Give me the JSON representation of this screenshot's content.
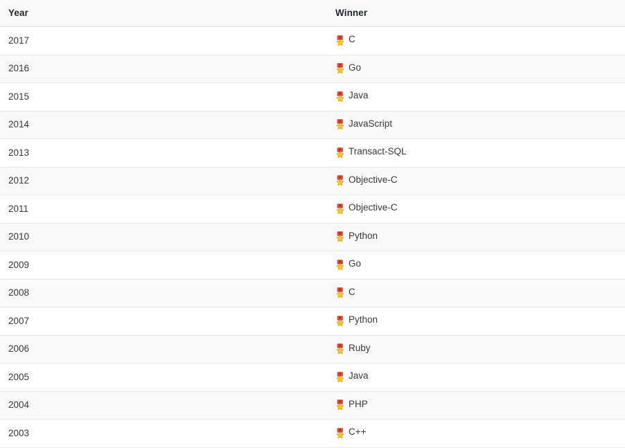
{
  "table": {
    "columns": [
      {
        "key": "year",
        "label": "Year"
      },
      {
        "key": "winner",
        "label": "Winner"
      }
    ],
    "icon": {
      "name": "medal-icon",
      "glyph": "🎖",
      "ribbon_color": "#e5442f",
      "ribbon_shadow_color": "#b8321f",
      "star_color": "#f7c836",
      "star_outline_color": "#d79a17"
    },
    "rows": [
      {
        "year": "2017",
        "winner": "C"
      },
      {
        "year": "2016",
        "winner": "Go"
      },
      {
        "year": "2015",
        "winner": "Java"
      },
      {
        "year": "2014",
        "winner": "JavaScript"
      },
      {
        "year": "2013",
        "winner": "Transact-SQL"
      },
      {
        "year": "2012",
        "winner": "Objective-C"
      },
      {
        "year": "2011",
        "winner": "Objective-C"
      },
      {
        "year": "2010",
        "winner": "Python"
      },
      {
        "year": "2009",
        "winner": "Go"
      },
      {
        "year": "2008",
        "winner": "C"
      },
      {
        "year": "2007",
        "winner": "Python"
      },
      {
        "year": "2006",
        "winner": "Ruby"
      },
      {
        "year": "2005",
        "winner": "Java"
      },
      {
        "year": "2004",
        "winner": "PHP"
      },
      {
        "year": "2003",
        "winner": "C++"
      }
    ]
  },
  "colors": {
    "header_background": "#f9f9f9",
    "header_border": "#dfdfdf",
    "row_background": "#ffffff",
    "row_background_alt": "#f9f9f9",
    "row_border": "#e8e8e8",
    "header_text": "#24292e",
    "body_text": "#3c3c3c"
  }
}
